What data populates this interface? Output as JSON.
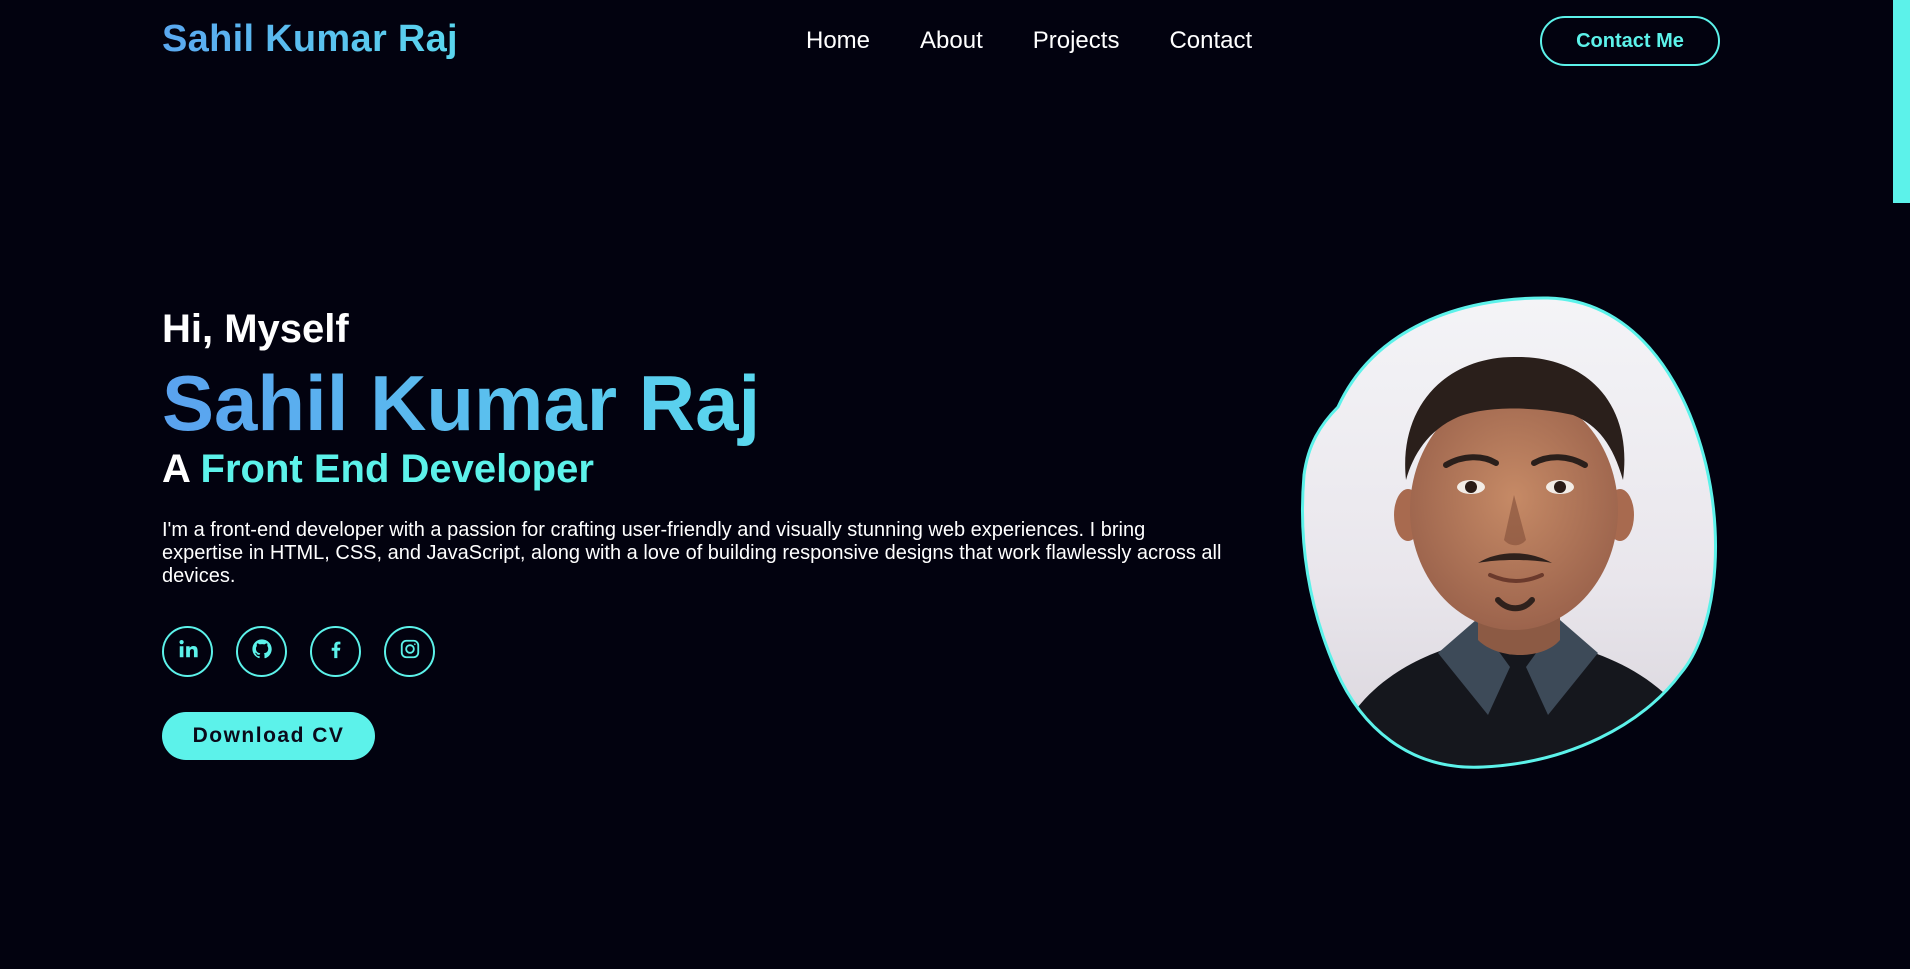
{
  "header": {
    "logo": "Sahil Kumar Raj",
    "nav": [
      "Home",
      "About",
      "Projects",
      "Contact"
    ],
    "cta_label": "Contact Me"
  },
  "hero": {
    "greeting": "Hi, Myself",
    "name": "Sahil Kumar Raj",
    "role_prefix": "A",
    "role": "Front End Developer",
    "bio": "I'm a front-end developer with a passion for crafting user-friendly and visually stunning web experiences. I bring expertise in HTML, CSS, and JavaScript, along with a love of building responsive designs that work flawlessly across all devices.",
    "socials": [
      {
        "icon": "linkedin-icon"
      },
      {
        "icon": "github-icon"
      },
      {
        "icon": "facebook-icon"
      },
      {
        "icon": "instagram-icon"
      }
    ],
    "download_label": "Download CV"
  },
  "colors": {
    "background": "#02020f",
    "accent": "#5cf2ea",
    "name_gradient_start": "#5aa2ef",
    "name_gradient_end": "#5ad8ee"
  }
}
